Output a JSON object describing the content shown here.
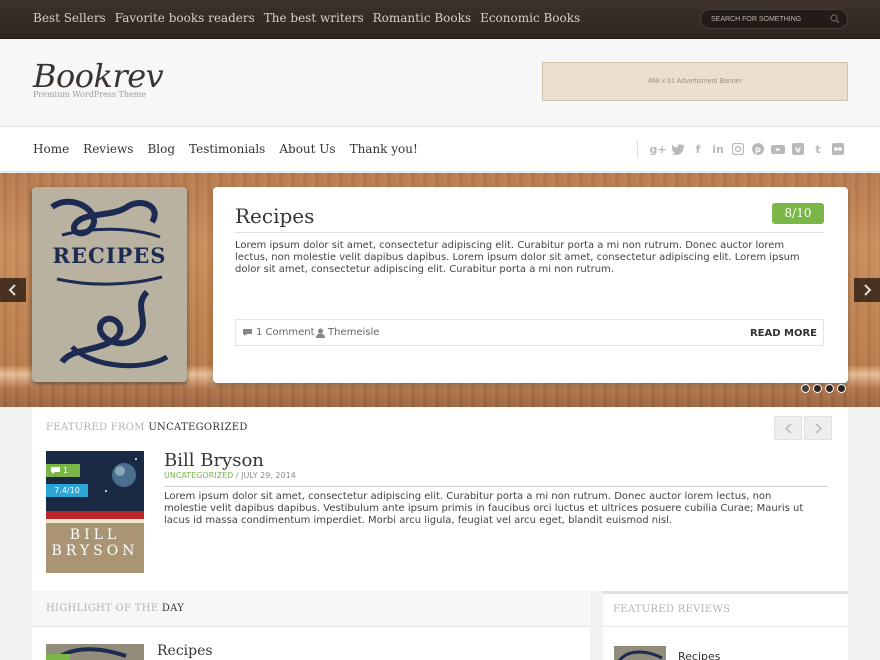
{
  "topbar": {
    "nav": [
      "Best Sellers",
      "Favorite books readers",
      "The best writers",
      "Romantic Books",
      "Economic Books"
    ],
    "search_placeholder": "SEARCH FOR SOMETHING"
  },
  "header": {
    "logo": "Bookrev",
    "tagline": "Premium WordPress Theme",
    "ad_text": "468 x 61 Advertisment Banner"
  },
  "mainnav": {
    "links": [
      "Home",
      "Reviews",
      "Blog",
      "Testimonials",
      "About Us",
      "Thank you!"
    ],
    "social": [
      "google-plus-icon",
      "twitter-icon",
      "facebook-icon",
      "linkedin-icon",
      "instagram-icon",
      "pinterest-icon",
      "youtube-icon",
      "vimeo-icon",
      "tumblr-icon",
      "flickr-icon"
    ]
  },
  "slider": {
    "cover_word": "RECIPES",
    "title": "Recipes",
    "score": "8/10",
    "text": "Lorem ipsum dolor sit amet, consectetur adipiscing elit. Curabitur porta a mi non rutrum. Donec auctor lorem lectus, non molestie velit dapibus dapibus.  Lorem ipsum dolor sit amet, consectetur adipiscing elit.  Lorem ipsum dolor sit amet, consectetur adipiscing elit. Curabitur porta a mi non rutrum.",
    "comments": "1 Comment",
    "author": "Themeisle",
    "read_more": "READ MORE",
    "dots": 4,
    "active_dot": 0
  },
  "featured": {
    "label_prefix": "FEATURED FROM",
    "label_category": "UNCATEGORIZED",
    "cover_name_1": "BILL",
    "cover_name_2": "BRYSON",
    "comment_count": "1",
    "score": "7.4/10",
    "title": "Bill Bryson",
    "category": "UNCATEGORIZED",
    "date": "/ JULY 29, 2014",
    "text": "Lorem ipsum dolor sit amet, consectetur adipiscing elit. Curabitur porta a mi non rutrum. Donec auctor lorem lectus, non molestie velit dapibus dapibus. Vestibulum ante ipsum primis in faucibus orci luctus et ultrices posuere cubilia Curae; Mauris ut lacus id massa condimentum imperdiet. Morbi arcu ligula, feugiat vel arcu eget, blandit euismod nisl."
  },
  "highlight": {
    "label_prefix": "HIGHLIGHT OF THE",
    "label_strong": "DAY",
    "title": "Recipes"
  },
  "reviews": {
    "label": "FEATURED REVIEWS",
    "item_title": "Recipes"
  },
  "colors": {
    "accent_green": "#7ab648",
    "accent_blue": "#2ba5d6",
    "topbar": "#3c322b"
  }
}
